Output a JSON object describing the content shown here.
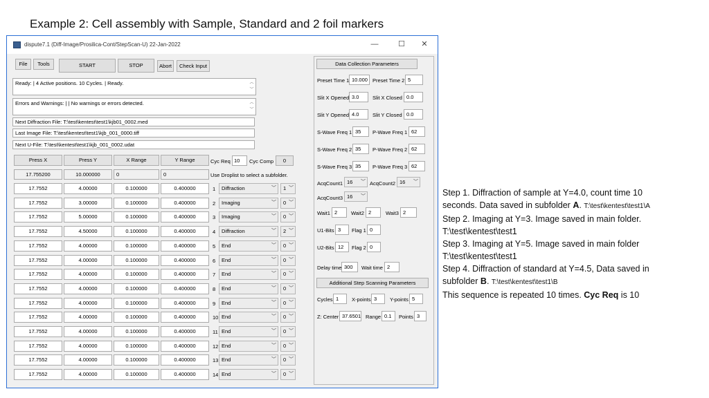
{
  "slide": {
    "title": "Example 2: Cell assembly with Sample, Standard and 2 foil markers"
  },
  "window": {
    "title": "dispute7.1  (Diff-Image/Prosilica-Cont/StepScan-U)  22-Jan-2022",
    "controls": {
      "minimize": "—",
      "maximize": "☐",
      "close": "✕"
    }
  },
  "toolbar": {
    "file": "File",
    "tools": "Tools",
    "start": "START",
    "stop": "STOP",
    "abort": "Abort",
    "check_input": "Check Input"
  },
  "status": {
    "ready": "Ready: | 4 Active positions.        10 Cycles. | Ready.",
    "errors": "Errors and Warnings: |     | No warnings or errors detected."
  },
  "files": {
    "next_diffraction": "Next Diffraction File:  T:\\test\\kentest\\test1\\kjb01_0002.med",
    "last_image": "Last Image File:        T:\\test\\kentest\\test1\\kjb_001_0000.tiff",
    "next_ufile": "Next U-File:  T:\\test\\kentest\\test1\\kjb_001_0002.udat"
  },
  "grid": {
    "headers": [
      "Press X",
      "Press Y",
      "X Range",
      "Y Range"
    ],
    "current": [
      "17.755200",
      "10.000000",
      "0",
      "0"
    ],
    "cyc_req_label": "Cyc Req",
    "cyc_req": "10",
    "cyc_comp_label": "Cyc Comp",
    "cyc_comp": "0",
    "droplist_hint": "Use Droplist to select a subfolder.",
    "rows": [
      {
        "x": "17.7552",
        "y": "4.00000",
        "xr": "0.100000",
        "yr": "0.400000",
        "n": "1",
        "mode": "Diffraction",
        "sub": "1"
      },
      {
        "x": "17.7552",
        "y": "3.00000",
        "xr": "0.100000",
        "yr": "0.400000",
        "n": "2",
        "mode": "Imaging",
        "sub": "0"
      },
      {
        "x": "17.7552",
        "y": "5.00000",
        "xr": "0.100000",
        "yr": "0.400000",
        "n": "3",
        "mode": "Imaging",
        "sub": "0"
      },
      {
        "x": "17.7552",
        "y": "4.50000",
        "xr": "0.100000",
        "yr": "0.400000",
        "n": "4",
        "mode": "Diffraction",
        "sub": "2"
      },
      {
        "x": "17.7552",
        "y": "4.00000",
        "xr": "0.100000",
        "yr": "0.400000",
        "n": "5",
        "mode": "End",
        "sub": "0"
      },
      {
        "x": "17.7552",
        "y": "4.00000",
        "xr": "0.100000",
        "yr": "0.400000",
        "n": "6",
        "mode": "End",
        "sub": "0"
      },
      {
        "x": "17.7552",
        "y": "4.00000",
        "xr": "0.100000",
        "yr": "0.400000",
        "n": "7",
        "mode": "End",
        "sub": "0"
      },
      {
        "x": "17.7552",
        "y": "4.00000",
        "xr": "0.100000",
        "yr": "0.400000",
        "n": "8",
        "mode": "End",
        "sub": "0"
      },
      {
        "x": "17.7552",
        "y": "4.00000",
        "xr": "0.100000",
        "yr": "0.400000",
        "n": "9",
        "mode": "End",
        "sub": "0"
      },
      {
        "x": "17.7552",
        "y": "4.00000",
        "xr": "0.100000",
        "yr": "0.400000",
        "n": "10",
        "mode": "End",
        "sub": "0"
      },
      {
        "x": "17.7552",
        "y": "4.00000",
        "xr": "0.100000",
        "yr": "0.400000",
        "n": "11",
        "mode": "End",
        "sub": "0"
      },
      {
        "x": "17.7552",
        "y": "4.00000",
        "xr": "0.100000",
        "yr": "0.400000",
        "n": "12",
        "mode": "End",
        "sub": "0"
      },
      {
        "x": "17.7552",
        "y": "4.00000",
        "xr": "0.100000",
        "yr": "0.400000",
        "n": "13",
        "mode": "End",
        "sub": "0"
      },
      {
        "x": "17.7552",
        "y": "4.00000",
        "xr": "0.100000",
        "yr": "0.400000",
        "n": "14",
        "mode": "End",
        "sub": "0"
      }
    ]
  },
  "params": {
    "header": "Data Collection Parameters",
    "preset_time_1_label": "Preset Time 1",
    "preset_time_1": "10.000",
    "preset_time_2_label": "Preset Time 2",
    "preset_time_2": "5",
    "slit_x_opened_label": "Slit X Opened",
    "slit_x_opened": "3.0",
    "slit_x_closed_label": "Slit X Closed",
    "slit_x_closed": "0.0",
    "slit_y_opened_label": "Slit Y Opened",
    "slit_y_opened": "4.0",
    "slit_y_closed_label": "Slit Y Closed",
    "slit_y_closed": "0.0",
    "swave_1_label": "S-Wave Freq 1",
    "swave_1": "35",
    "pwave_1_label": "P-Wave Freq 1",
    "pwave_1": "62",
    "swave_2_label": "S-Wave Freq 2",
    "swave_2": "35",
    "pwave_2_label": "P-Wave Freq 2",
    "pwave_2": "62",
    "swave_3_label": "S-Wave Freq 3",
    "swave_3": "35",
    "pwave_3_label": "P-Wave Freq 3",
    "pwave_3": "62",
    "acq1_label": "AcqCount1",
    "acq1": "16",
    "acq2_label": "AcqCount2",
    "acq2": "16",
    "acq3_label": "AcqCount3",
    "acq3": "16",
    "wait1_label": "Wait1",
    "wait1": "2",
    "wait2_label": "Wait2",
    "wait2": "2",
    "wait3_label": "Wait3",
    "wait3": "2",
    "u1bits_label": "U1-Bits",
    "u1bits": "3",
    "flag1_label": "Flag 1",
    "flag1": "0",
    "u2bits_label": "U2-Bits",
    "u2bits": "12",
    "flag2_label": "Flag 2",
    "flag2": "0",
    "delay_label": "Delay time",
    "delay": "300",
    "waittime_label": "Wait time",
    "waittime": "2",
    "additional_header": "Additional Step Scanning Parameters",
    "cycles_label": "Cycles",
    "cycles": "1",
    "xpoints_label": "X-points",
    "xpoints": "3",
    "ypoints_label": "Y-points",
    "ypoints": "5",
    "zcenter_label": "Z: Center",
    "zcenter": "37.6501",
    "range_label": "Range",
    "range": "0.1",
    "points_label": "Points",
    "points": "3"
  },
  "notes": {
    "l1": "Step 1. Diffraction of sample at Y=4.0, count time 10",
    "l2a": "seconds. Data saved in subfolder ",
    "l2b": "A",
    "l2c": ". ",
    "l2d": "T:\\test\\kentest\\test1\\A",
    "l3": "Step 2. Imaging at Y=3. Image saved in main folder.",
    "l4": "T:\\test\\kentest\\test1",
    "l5": "Step 3. Imaging at Y=5. Image saved in main folder",
    "l6": "T:\\test\\kentest\\test1",
    "l7": "Step 4. Diffraction of standard at Y=4.5, Data saved in",
    "l8a": "subfolder ",
    "l8b": "B",
    "l8c": ". ",
    "l8d": "T:\\test\\kentest\\test1\\B",
    "l9a": "This sequence is repeated 10 times. ",
    "l9b": "Cyc Req",
    "l9c": " is 10"
  }
}
